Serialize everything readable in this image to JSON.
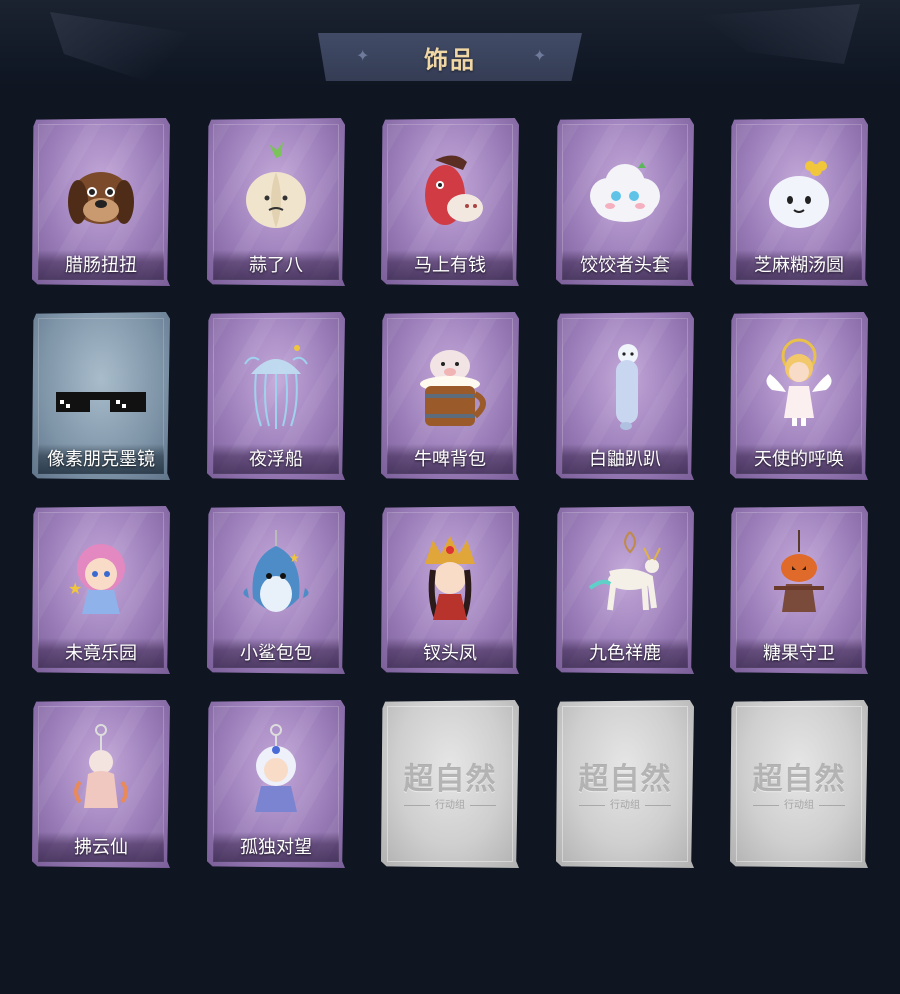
{
  "header": {
    "title": "饰品"
  },
  "items": [
    {
      "name": "腊肠扭扭",
      "art": "dog-head-icon",
      "card": "purple"
    },
    {
      "name": "蒜了八",
      "art": "garlic-icon",
      "card": "purple"
    },
    {
      "name": "马上有钱",
      "art": "red-horse-icon",
      "card": "purple"
    },
    {
      "name": "饺饺者头套",
      "art": "cloud-face-icon",
      "card": "purple"
    },
    {
      "name": "芝麻糊汤圆",
      "art": "dumpling-icon",
      "card": "purple"
    },
    {
      "name": "像素朋克墨镜",
      "art": "pixel-sunglasses-icon",
      "card": "blue"
    },
    {
      "name": "夜浮船",
      "art": "jellyfish-icon",
      "card": "purple"
    },
    {
      "name": "牛啤背包",
      "art": "cow-beer-mug-icon",
      "card": "purple"
    },
    {
      "name": "白鼬趴趴",
      "art": "white-ferret-icon",
      "card": "purple"
    },
    {
      "name": "天使的呼唤",
      "art": "angel-doll-icon",
      "card": "purple"
    },
    {
      "name": "未竟乐园",
      "art": "pink-hair-doll-icon",
      "card": "purple"
    },
    {
      "name": "小鲨包包",
      "art": "shark-plush-icon",
      "card": "purple"
    },
    {
      "name": "钗头凤",
      "art": "phoenix-crown-doll-icon",
      "card": "purple"
    },
    {
      "name": "九色祥鹿",
      "art": "deer-charm-icon",
      "card": "purple"
    },
    {
      "name": "糖果守卫",
      "art": "pumpkin-scarecrow-icon",
      "card": "purple"
    },
    {
      "name": "拂云仙",
      "art": "cloud-fairy-charm-icon",
      "card": "purple"
    },
    {
      "name": "孤独对望",
      "art": "white-hair-doll-icon",
      "card": "purple"
    },
    {
      "name": "",
      "art": "locked-placeholder",
      "card": "grey",
      "logo": "超自然",
      "sub": "行动组"
    },
    {
      "name": "",
      "art": "locked-placeholder",
      "card": "grey",
      "logo": "超自然",
      "sub": "行动组"
    },
    {
      "name": "",
      "art": "locked-placeholder",
      "card": "grey",
      "logo": "超自然",
      "sub": "行动组"
    }
  ],
  "colors": {
    "background": "#0f1521",
    "banner": "#3b445d",
    "title_gold": "#f0d8a6",
    "card_purple": "#9c7fba",
    "card_blue": "#7f95a8",
    "card_grey": "#cfcfcf"
  }
}
